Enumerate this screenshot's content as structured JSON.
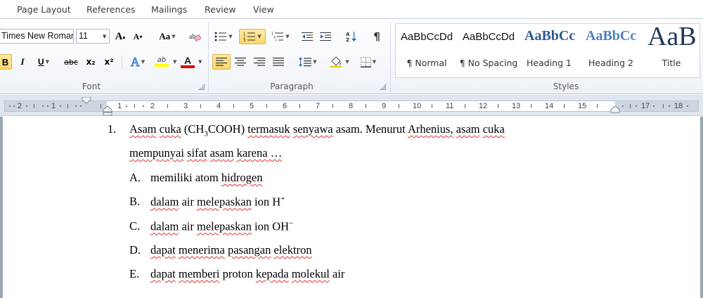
{
  "tabs": [
    "Page Layout",
    "References",
    "Mailings",
    "Review",
    "View"
  ],
  "font_group": {
    "font_name": "Times New Roman",
    "font_size": "11",
    "label": "Font",
    "grow_font": "A",
    "shrink_font": "A",
    "change_case": "Aa",
    "bold": "B",
    "italic": "I",
    "underline": "U",
    "strikethrough": "abc",
    "subscript": "x₂",
    "superscript": "x²",
    "text_effects": "A",
    "highlight": "ab",
    "font_color": "A",
    "highlight_color": "#ffff00",
    "font_color_value": "#e00000"
  },
  "paragraph_group": {
    "label": "Paragraph",
    "show_marks": "¶"
  },
  "styles_group": {
    "label": "Styles",
    "items": [
      {
        "preview": "AaBbCcDd",
        "name": "¶ Normal"
      },
      {
        "preview": "AaBbCcDd",
        "name": "¶ No Spacing"
      },
      {
        "preview": "AaBbCc",
        "name": "Heading 1"
      },
      {
        "preview": "AaBbCc",
        "name": "Heading 2"
      },
      {
        "preview": "AaB",
        "name": "Title"
      }
    ]
  },
  "ruler": {
    "numbers": [
      "2",
      "1",
      "1",
      "2",
      "3",
      "4",
      "5",
      "6",
      "7",
      "8",
      "9",
      "10",
      "11",
      "12",
      "13",
      "14",
      "15",
      "17",
      "18"
    ]
  },
  "document": {
    "question_number": "1.",
    "question_line1_a": "Asam",
    "question_line1_b": "cuka",
    "question_line1_c": "(CH",
    "question_line1_sub": "3",
    "question_line1_d": "COOH)",
    "question_line1_e": "termasuk",
    "question_line1_f": "senyawa",
    "question_line1_g": "asam. Menurut",
    "question_line1_h": "Arhenius,",
    "question_line1_i": "asam",
    "question_line1_j": "cuka",
    "question_line2_a": "mempunyai",
    "question_line2_b": "sifat",
    "question_line2_c": "asam",
    "question_line2_d": "karena …",
    "options": [
      {
        "letter": "A.",
        "parts": [
          "memiliki",
          " atom ",
          "hidrogen"
        ],
        "sup": ""
      },
      {
        "letter": "B.",
        "parts": [
          "dalam",
          " air ",
          "melepaskan",
          " ion H"
        ],
        "sup": "+"
      },
      {
        "letter": "C.",
        "parts": [
          "dalam",
          " air ",
          "melepaskan",
          " ion OH"
        ],
        "sup": "−"
      },
      {
        "letter": "D.",
        "parts": [
          "dapat",
          " ",
          "menerima",
          " ",
          "pasangan",
          " ",
          "elektron"
        ],
        "sup": ""
      },
      {
        "letter": "E.",
        "parts": [
          "dapat",
          " ",
          "memberi",
          " proton ",
          "kepada",
          " ",
          "molekul",
          " air"
        ],
        "sup": ""
      }
    ]
  }
}
